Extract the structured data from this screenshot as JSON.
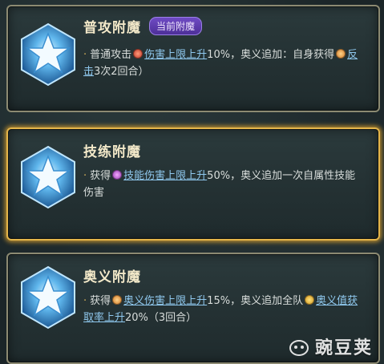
{
  "cards": [
    {
      "title": "普攻附魔",
      "badge": "当前附魔",
      "desc": {
        "p1": "普通攻击",
        "l1": "伤害上限上升",
        "p2": "10%，奥义追加：自身获得",
        "l2": "反击",
        "p3": "3次2回合）"
      },
      "selected": false
    },
    {
      "title": "技练附魔",
      "desc": {
        "p1": "获得",
        "l1": "技能伤害上限上升",
        "p2": "50%，奥义追加一次自属性技能伤害"
      },
      "selected": true
    },
    {
      "title": "奥义附魔",
      "desc": {
        "p1": "获得",
        "l1": "奥义伤害上限上升",
        "p2": "15%，奥义追加全队",
        "l2": "奥义值获取率上升",
        "p3": "20%（3回合）"
      },
      "selected": false
    }
  ],
  "watermark": {
    "text": "豌豆荚"
  },
  "colors": {
    "selected_border": "#e4b54a",
    "link": "#8fc8ee",
    "title": "#f3e9c9",
    "badge": "#5a3aa8"
  },
  "icons": [
    "star-emblem-icon",
    "damage-up-icon",
    "counter-icon",
    "skill-damage-icon",
    "ultimate-damage-icon",
    "ultimate-gain-icon"
  ]
}
